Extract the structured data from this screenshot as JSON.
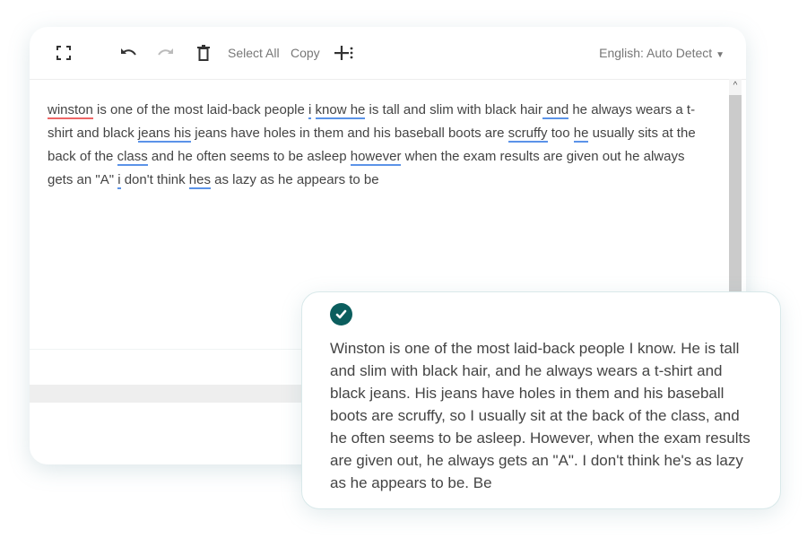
{
  "toolbar": {
    "select_all": "Select All",
    "copy": "Copy",
    "language": "English: Auto Detect",
    "icons": [
      "fullscreen-icon",
      "undo-icon",
      "redo-icon",
      "trash-icon",
      "add-more-icon",
      "caret-down-icon"
    ]
  },
  "editor": {
    "segments": [
      {
        "t": "winston",
        "u": "red"
      },
      {
        "t": " is one of the most laid-back people "
      },
      {
        "t": "i",
        "u": "blue"
      },
      {
        "t": " "
      },
      {
        "t": "know he",
        "u": "blue"
      },
      {
        "t": " is tall and slim with black hair"
      },
      {
        "t": " and",
        "u": "blue"
      },
      {
        "t": " he always wears a t-shirt and black "
      },
      {
        "t": "jeans his",
        "u": "blue"
      },
      {
        "t": " jeans have holes in them and his baseball boots are "
      },
      {
        "t": "scruffy",
        "u": "blue"
      },
      {
        "t": " too "
      },
      {
        "t": "he",
        "u": "blue"
      },
      {
        "t": " usually sits at the back of the "
      },
      {
        "t": "class",
        "u": "blue"
      },
      {
        "t": " and he often seems to be asleep "
      },
      {
        "t": "however",
        "u": "blue"
      },
      {
        "t": " when the exam results are given out he always gets an \"A\" "
      },
      {
        "t": "i",
        "u": "blue"
      },
      {
        "t": " don't think "
      },
      {
        "t": "hes",
        "u": "blue"
      },
      {
        "t": " as lazy as he appears to be"
      }
    ]
  },
  "result": {
    "text": "Winston is one of the most laid-back people I know. He is tall and slim with black hair, and he always wears a t-shirt and black jeans. His jeans have holes in them and his baseball boots are scruffy, so I usually sit at the back of the class, and he often seems to be asleep. However, when the exam results are given out, he always gets an \"A\". I don't think he's as lazy as he appears to be. Be",
    "icon": "check-circle-icon",
    "accent": "#0b5e5e"
  }
}
